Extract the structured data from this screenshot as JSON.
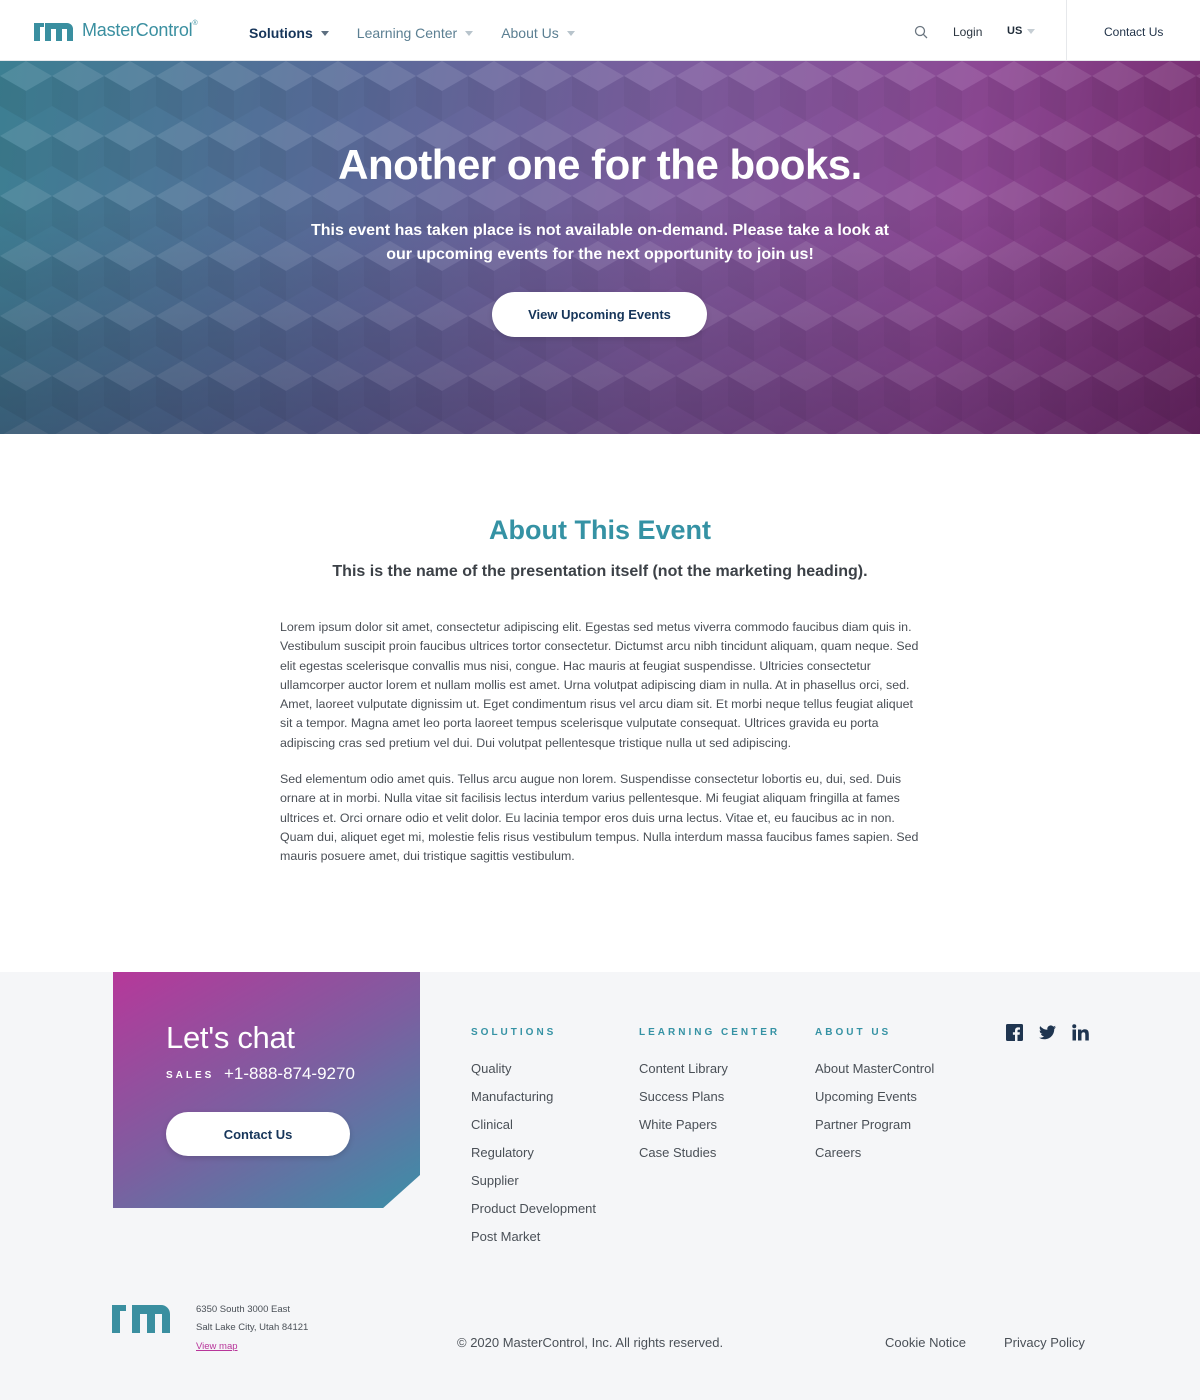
{
  "header": {
    "brand": "MasterControl",
    "brand_mark": "®",
    "nav": [
      {
        "label": "Solutions",
        "active": true
      },
      {
        "label": "Learning Center",
        "active": false
      },
      {
        "label": "About Us",
        "active": false
      }
    ],
    "search_icon": "search-icon",
    "login_label": "Login",
    "locale_label": "US",
    "contact_label": "Contact Us"
  },
  "hero": {
    "title": "Another one for the books.",
    "subtitle": "This event has taken place is not available on-demand. Please take a look at our upcoming events for the next opportunity to join us!",
    "button_label": "View Upcoming Events",
    "colors": {
      "start": "#3c7f92",
      "end": "#742a6b"
    }
  },
  "about": {
    "title": "About This Event",
    "subtitle": "This is the name of the presentation itself (not the marketing heading).",
    "paragraphs": [
      "Lorem ipsum dolor sit amet, consectetur adipiscing elit. Egestas sed metus viverra commodo faucibus diam quis in. Vestibulum suscipit proin faucibus ultrices tortor consectetur. Dictumst arcu nibh tincidunt aliquam, quam neque. Sed elit egestas scelerisque convallis mus nisi, congue. Hac mauris at feugiat suspendisse. Ultricies consectetur ullamcorper auctor lorem et nullam mollis est amet. Urna volutpat adipiscing diam in nulla. At in phasellus orci, sed. Amet, laoreet vulputate dignissim ut. Eget condimentum risus vel arcu diam sit. Et morbi neque tellus feugiat aliquet sit a tempor. Magna amet leo porta laoreet tempus scelerisque vulputate consequat. Ultrices gravida eu porta adipiscing cras sed pretium vel dui. Dui volutpat pellentesque tristique nulla ut sed adipiscing.",
      "Sed elementum odio amet quis. Tellus arcu augue non lorem. Suspendisse consectetur lobortis eu, dui, sed. Duis ornare at in morbi. Nulla vitae sit facilisis lectus interdum varius pellentesque. Mi feugiat aliquam fringilla at fames ultrices et. Orci ornare odio et velit dolor. Eu lacinia tempor eros duis urna lectus. Vitae et, eu faucibus ac in non. Quam dui, aliquet eget mi, molestie felis risus vestibulum tempus. Nulla interdum massa faucibus fames sapien. Sed mauris posuere amet, dui tristique sagittis vestibulum."
    ]
  },
  "footer": {
    "chat": {
      "title": "Let's chat",
      "sales_label": "SALES",
      "phone": "+1-888-874-9270",
      "button_label": "Contact Us"
    },
    "columns": [
      {
        "heading": "SOLUTIONS",
        "links": [
          "Quality",
          "Manufacturing",
          "Clinical",
          "Regulatory",
          "Supplier",
          "Product Development",
          "Post Market"
        ]
      },
      {
        "heading": "LEARNING CENTER",
        "links": [
          "Content Library",
          "Success Plans",
          "White Papers",
          "Case Studies"
        ]
      },
      {
        "heading": "ABOUT US",
        "links": [
          "About MasterControl",
          "Upcoming Events",
          "Partner Program",
          "Careers"
        ]
      }
    ],
    "social": [
      "facebook-icon",
      "twitter-icon",
      "linkedin-icon"
    ],
    "address_line1": "6350 South 3000 East",
    "address_line2": "Salt Lake City, Utah 84121",
    "view_map": "View map",
    "copyright": "© 2020 MasterControl, Inc. All rights reserved.",
    "cookie_notice": "Cookie Notice",
    "privacy_policy": "Privacy Policy"
  }
}
